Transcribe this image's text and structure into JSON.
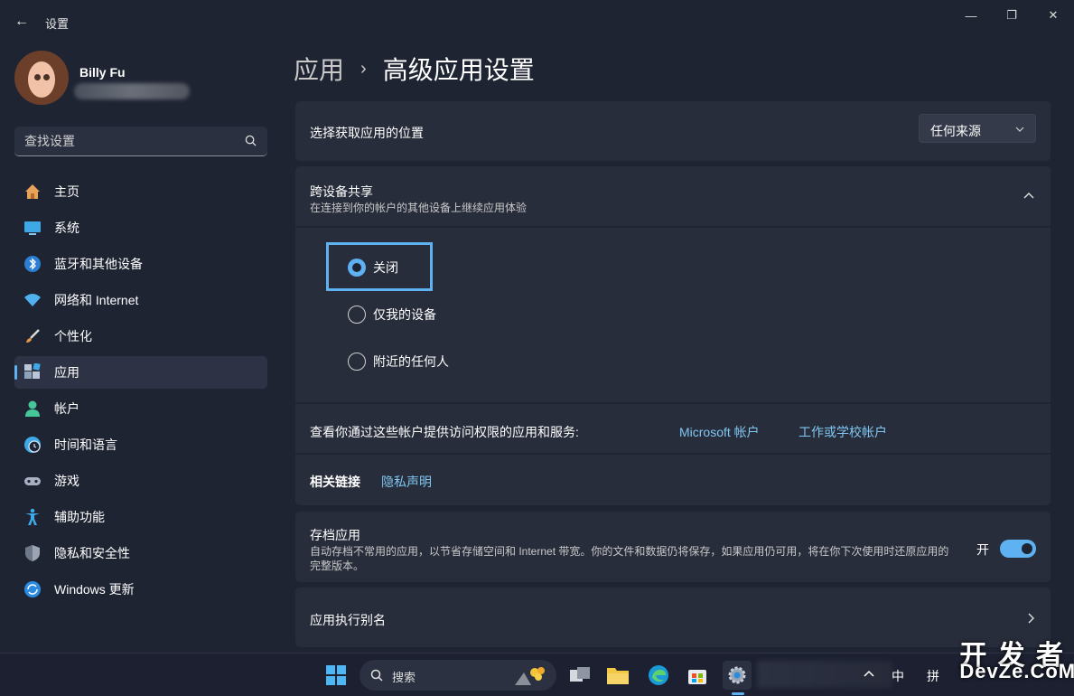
{
  "window": {
    "app_title": "设置",
    "back_glyph": "←",
    "minimize_glyph": "—",
    "maximize_glyph": "❐",
    "close_glyph": "✕"
  },
  "profile": {
    "name": "Billy Fu"
  },
  "search": {
    "placeholder": "查找设置"
  },
  "sidebar": {
    "items": [
      {
        "label": "主页",
        "icon": "home-icon",
        "active": false
      },
      {
        "label": "系统",
        "icon": "monitor-icon",
        "active": false
      },
      {
        "label": "蓝牙和其他设备",
        "icon": "bluetooth-icon",
        "active": false
      },
      {
        "label": "网络和 Internet",
        "icon": "wifi-icon",
        "active": false
      },
      {
        "label": "个性化",
        "icon": "brush-icon",
        "active": false
      },
      {
        "label": "应用",
        "icon": "apps-icon",
        "active": true
      },
      {
        "label": "帐户",
        "icon": "user-icon",
        "active": false
      },
      {
        "label": "时间和语言",
        "icon": "globe-clock-icon",
        "active": false
      },
      {
        "label": "游戏",
        "icon": "gamepad-icon",
        "active": false
      },
      {
        "label": "辅助功能",
        "icon": "accessibility-icon",
        "active": false
      },
      {
        "label": "隐私和安全性",
        "icon": "shield-icon",
        "active": false
      },
      {
        "label": "Windows 更新",
        "icon": "update-icon",
        "active": false
      }
    ]
  },
  "breadcrumb": {
    "parent": "应用",
    "separator": "›",
    "current": "高级应用设置"
  },
  "app_source": {
    "title": "选择获取应用的位置",
    "selected": "任何来源"
  },
  "cross_device": {
    "title": "跨设备共享",
    "subtitle": "在连接到你的帐户的其他设备上继续应用体验",
    "options": [
      {
        "label": "关闭",
        "checked": true
      },
      {
        "label": "仅我的设备",
        "checked": false
      },
      {
        "label": "附近的任何人",
        "checked": false
      }
    ],
    "accounts_text": "查看你通过这些帐户提供访问权限的应用和服务:",
    "microsoft_link": "Microsoft 帐户",
    "work_link": "工作或学校帐户",
    "related_label": "相关链接",
    "privacy_link": "隐私声明"
  },
  "archive": {
    "title": "存档应用",
    "description_line1": "自动存档不常用的应用，以节省存储空间和 Internet 带宽。你的文件和数据仍将保存，如果应用仍可用，将在你下次使用时还原应用的",
    "description_line2": "完整版本。",
    "toggle_label": "开",
    "toggle_on": true
  },
  "aliases": {
    "title": "应用执行别名"
  },
  "taskbar": {
    "search_label": "搜索",
    "ime_label": "中",
    "tray_partial": "拼"
  },
  "watermark": {
    "line1": "开 发 者",
    "line2": "DevZe.CoM"
  },
  "colors": {
    "accent": "#5fb2f2",
    "background": "#1f2433",
    "card": "#282d3b",
    "link": "#7fc6f2"
  }
}
